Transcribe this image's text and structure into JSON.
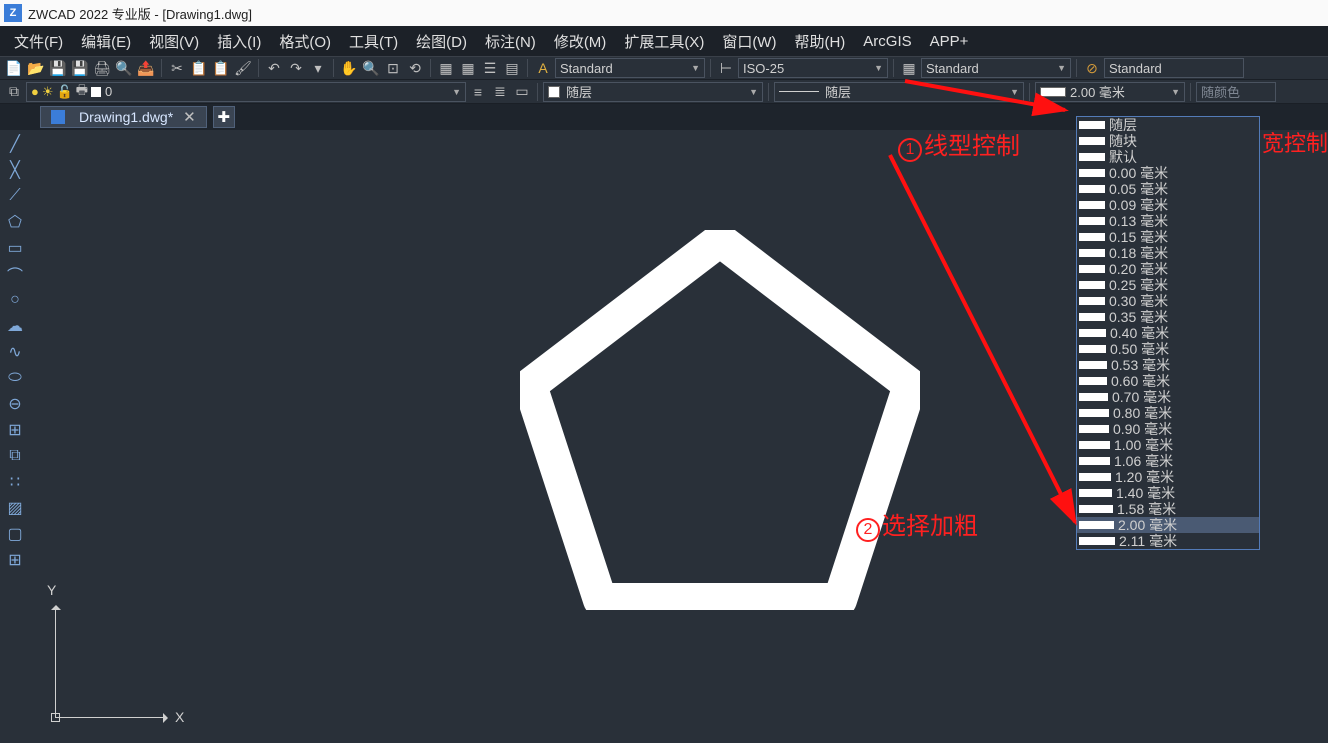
{
  "app": {
    "title": "ZWCAD 2022 专业版 - [Drawing1.dwg]"
  },
  "menu": {
    "file": "文件(F)",
    "edit": "编辑(E)",
    "view": "视图(V)",
    "insert": "插入(I)",
    "format": "格式(O)",
    "tools": "工具(T)",
    "draw": "绘图(D)",
    "dim": "标注(N)",
    "modify": "修改(M)",
    "ext": "扩展工具(X)",
    "window": "窗口(W)",
    "help": "帮助(H)",
    "arcgis": "ArcGIS",
    "app": "APP+"
  },
  "stylebar": {
    "text_style": "Standard",
    "dim_style": "ISO-25",
    "table_style": "Standard",
    "mls_style": "Standard"
  },
  "layerbar": {
    "layer": "0",
    "color_label": "随层",
    "linetype_label": "随层",
    "lineweight_selected": "2.00 毫米",
    "bycolor": "随颜色"
  },
  "tab": {
    "name": "Drawing1.dwg*"
  },
  "dropdown": {
    "items": [
      {
        "label": "随层",
        "bar": 26
      },
      {
        "label": "随块",
        "bar": 26
      },
      {
        "label": "默认",
        "bar": 26
      },
      {
        "label": "0.00 毫米",
        "bar": 26
      },
      {
        "label": "0.05 毫米",
        "bar": 26
      },
      {
        "label": "0.09 毫米",
        "bar": 26
      },
      {
        "label": "0.13 毫米",
        "bar": 26
      },
      {
        "label": "0.15 毫米",
        "bar": 26
      },
      {
        "label": "0.18 毫米",
        "bar": 26
      },
      {
        "label": "0.20 毫米",
        "bar": 26
      },
      {
        "label": "0.25 毫米",
        "bar": 26
      },
      {
        "label": "0.30 毫米",
        "bar": 26
      },
      {
        "label": "0.35 毫米",
        "bar": 26
      },
      {
        "label": "0.40 毫米",
        "bar": 27
      },
      {
        "label": "0.50 毫米",
        "bar": 27
      },
      {
        "label": "0.53 毫米",
        "bar": 28
      },
      {
        "label": "0.60 毫米",
        "bar": 28
      },
      {
        "label": "0.70 毫米",
        "bar": 29
      },
      {
        "label": "0.80 毫米",
        "bar": 30
      },
      {
        "label": "0.90 毫米",
        "bar": 30
      },
      {
        "label": "1.00 毫米",
        "bar": 31
      },
      {
        "label": "1.06 毫米",
        "bar": 31
      },
      {
        "label": "1.20 毫米",
        "bar": 32
      },
      {
        "label": "1.40 毫米",
        "bar": 33
      },
      {
        "label": "1.58 毫米",
        "bar": 34
      },
      {
        "label": "2.00 毫米",
        "bar": 35,
        "selected": true
      },
      {
        "label": "2.11 毫米",
        "bar": 36
      }
    ]
  },
  "annotations": {
    "a1": "线型控制",
    "a2": "选择加粗",
    "lw_control": "宽控制"
  },
  "axis": {
    "x": "X",
    "y": "Y"
  }
}
